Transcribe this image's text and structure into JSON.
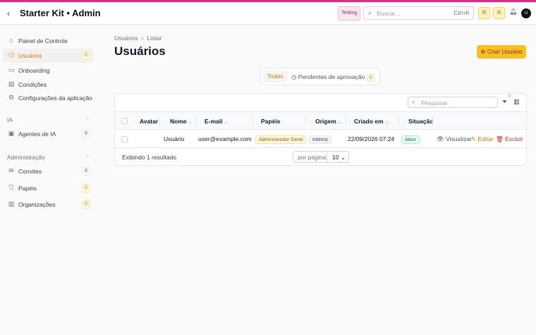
{
  "header": {
    "title": "Starter Kit • Admin",
    "env_badge": "Testing",
    "search_placeholder": "Buscar...",
    "search_shortcut": "Ctrl+K",
    "user_initial": "U",
    "accent_color": "#e6268c"
  },
  "sidebar": {
    "items": [
      {
        "label": "Painel de Controle",
        "icon": "home-icon"
      },
      {
        "label": "Usuários",
        "icon": "users-icon",
        "count": "0",
        "active": true
      },
      {
        "label": "Onboarding",
        "icon": "book-icon"
      },
      {
        "label": "Condições",
        "icon": "document-icon"
      },
      {
        "label": "Configurações da aplicação",
        "icon": "gear-icon"
      }
    ],
    "groups": [
      {
        "label": "IA",
        "items": [
          {
            "label": "Agentes de IA",
            "icon": "bot-icon",
            "count": "0"
          }
        ]
      },
      {
        "label": "Administração",
        "items": [
          {
            "label": "Convites",
            "icon": "mail-icon",
            "count": "0"
          },
          {
            "label": "Papéis",
            "icon": "shield-icon",
            "count": "0"
          },
          {
            "label": "Organizações",
            "icon": "building-icon",
            "count": "0"
          }
        ]
      }
    ]
  },
  "page": {
    "breadcrumb": [
      "Usuários",
      "Listar"
    ],
    "title": "Usuários",
    "create_button": "Criar Usuário",
    "tabs": {
      "all": "Todos",
      "pending": "Pendentes de aprovação",
      "pending_count": "0"
    }
  },
  "table": {
    "search_placeholder": "Pesquisar",
    "filter_count": "0",
    "columns": [
      "Avatar",
      "Nome",
      "E-mail",
      "Papéis",
      "Origem",
      "Criado em",
      "Situação"
    ],
    "rows": [
      {
        "name": "Usuário",
        "email": "user@example.com",
        "role": "Administrador Geral",
        "origin": "Interno",
        "created": "22/09/2026 07:24",
        "status": "Ativo"
      }
    ],
    "actions": {
      "view": "Visualizar",
      "edit": "Editar",
      "delete": "Excluir"
    },
    "footer": {
      "results": "Exibindo 1 resultado",
      "per_page_label": "por página",
      "per_page_value": "10"
    }
  }
}
